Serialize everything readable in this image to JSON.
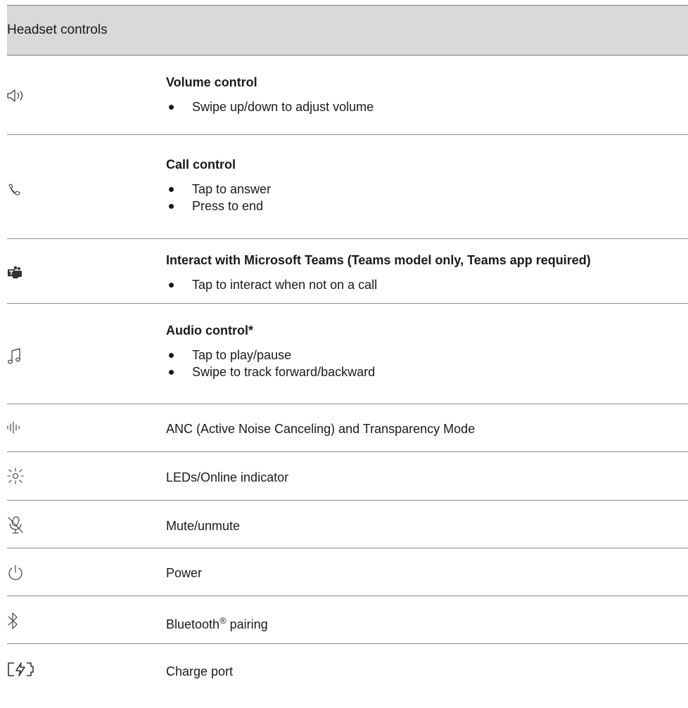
{
  "header": {
    "title": "Headset controls"
  },
  "rows": [
    {
      "icon": "volume-icon",
      "title": "Volume control",
      "bullets": [
        "Swipe up/down to adjust volume"
      ]
    },
    {
      "icon": "phone-icon",
      "title": "Call control",
      "bullets": [
        "Tap to answer",
        "Press to end"
      ]
    },
    {
      "icon": "teams-icon",
      "title": "Interact with Microsoft Teams (Teams model only, Teams app required)",
      "bullets": [
        "Tap to interact when not on a call"
      ]
    },
    {
      "icon": "music-note-icon",
      "title": "Audio control*",
      "bullets": [
        "Tap to play/pause",
        "Swipe to track forward/backward"
      ]
    },
    {
      "icon": "anc-waveform-icon",
      "text": "ANC (Active Noise Canceling) and Transparency Mode"
    },
    {
      "icon": "led-icon",
      "text": "LEDs/Online indicator"
    },
    {
      "icon": "mute-mic-icon",
      "text": "Mute/unmute"
    },
    {
      "icon": "power-icon",
      "text": "Power"
    },
    {
      "icon": "bluetooth-icon",
      "text_main": "Bluetooth",
      "text_sup": "®",
      "text_rest": " pairing"
    },
    {
      "icon": "charge-port-icon",
      "text": "Charge port"
    }
  ]
}
